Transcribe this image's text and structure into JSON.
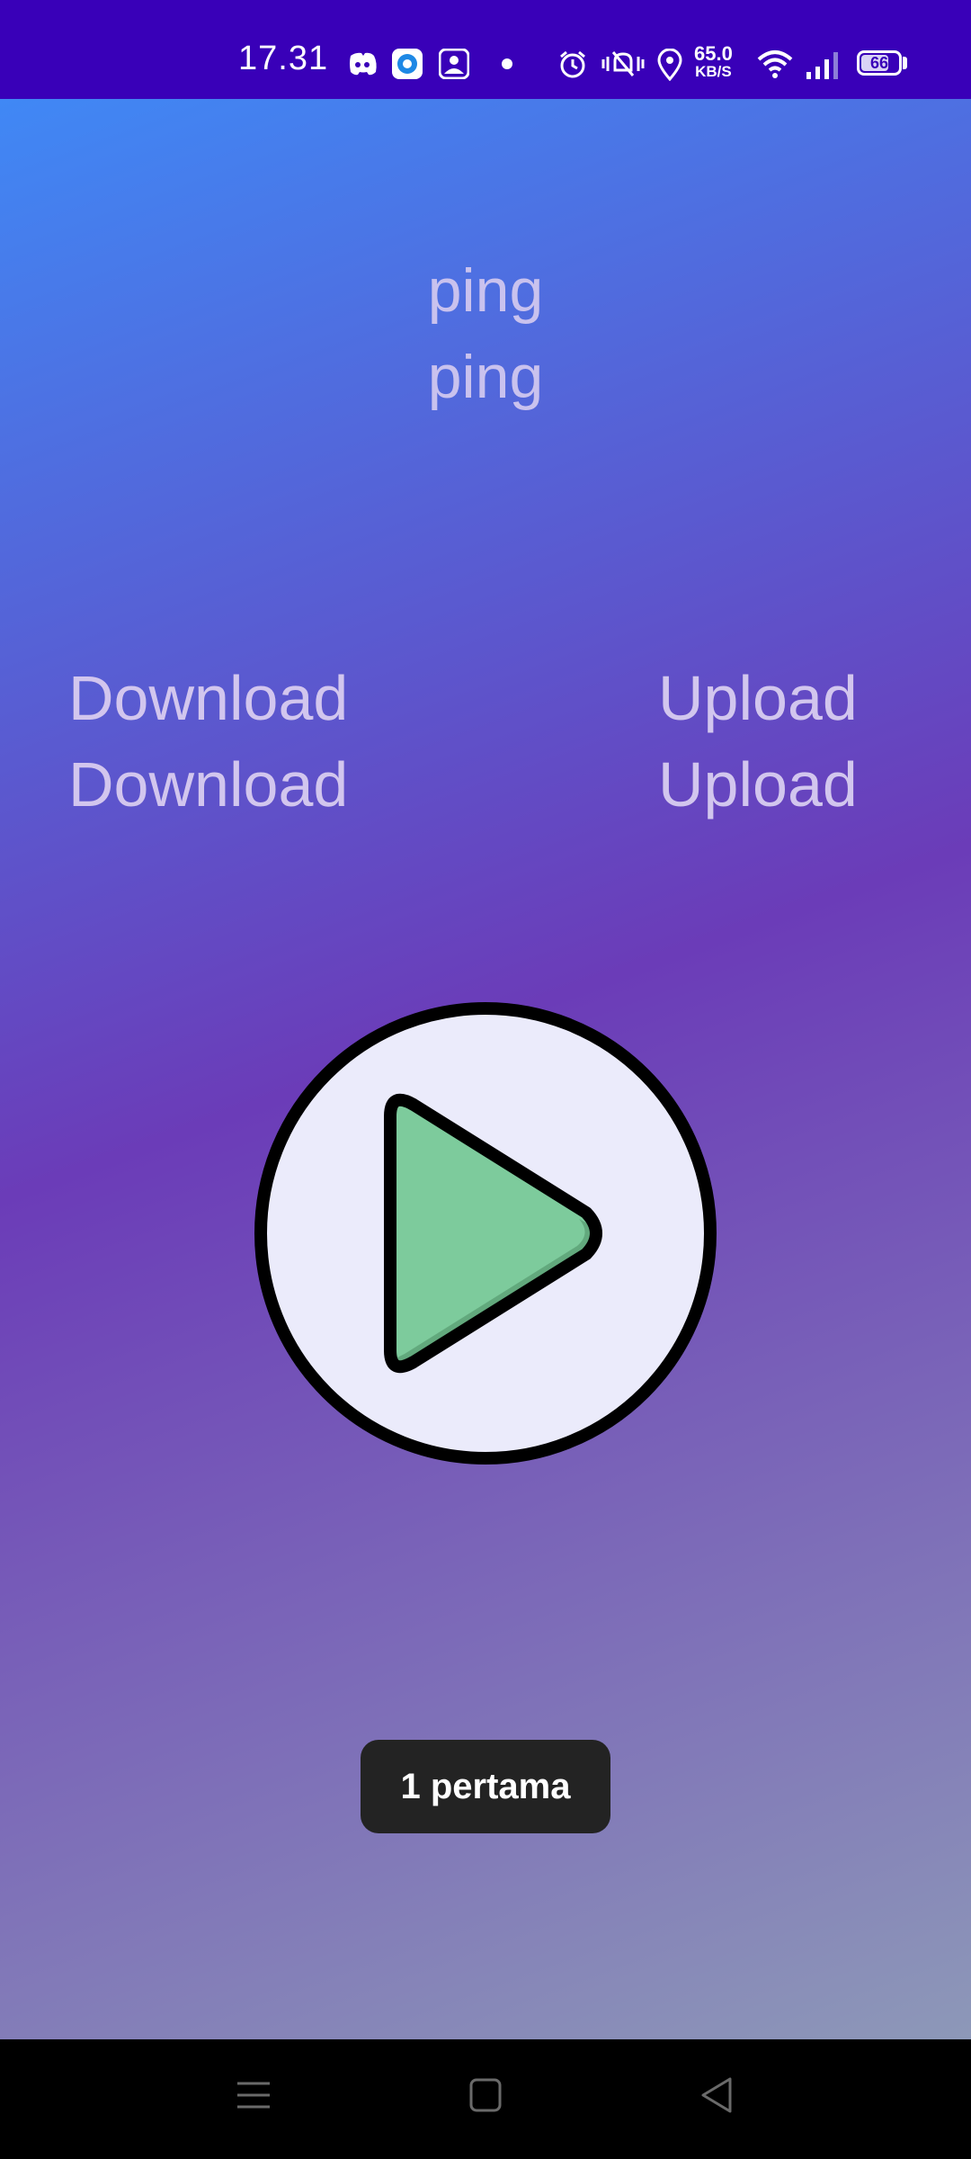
{
  "status_bar": {
    "time": "17.31",
    "net_speed_value": "65.0",
    "net_speed_unit": "KB/S",
    "battery": "66",
    "icons": [
      "discord-icon",
      "app-circle-icon",
      "photo-app-icon",
      "dot-icon",
      "alarm-icon",
      "mute-vibrate-icon",
      "location-icon",
      "wifi-icon",
      "signal-icon",
      "battery-icon"
    ]
  },
  "ping": {
    "label": "ping",
    "value": "ping"
  },
  "download": {
    "label": "Download",
    "value": "Download"
  },
  "upload": {
    "label": "Upload",
    "value": "Upload"
  },
  "play_button": {
    "icon": "play-icon"
  },
  "toast": {
    "text": "1 pertama"
  },
  "nav_bar": {
    "icons": [
      "menu-icon",
      "home-icon",
      "back-icon"
    ]
  },
  "colors": {
    "status_bar_bg": "#3900b8",
    "gradient_top": "#4088f5",
    "gradient_mid": "#6b3cb8",
    "gradient_bottom": "#8d98b8",
    "play_green": "#7dcb9c",
    "text_light": "#c9c2ee"
  }
}
